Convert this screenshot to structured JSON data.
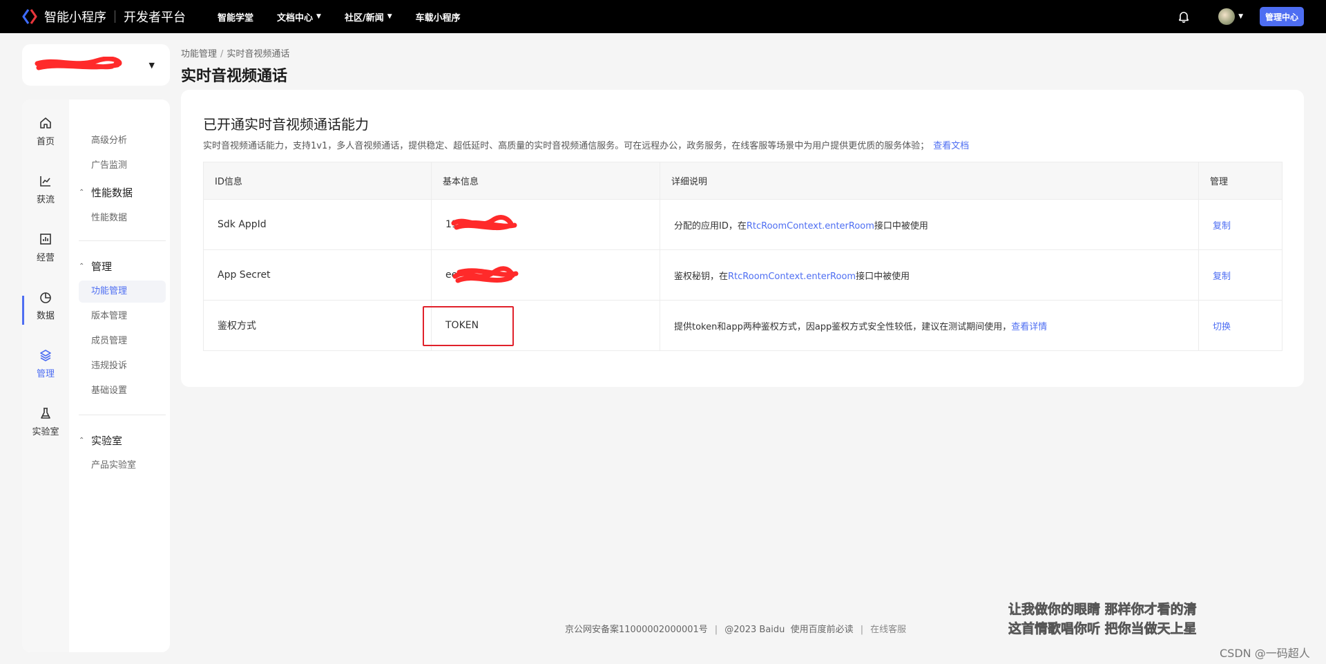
{
  "topbar": {
    "logo_name": "智能小程序",
    "logo_sub": "开发者平台",
    "nav": [
      {
        "label": "智能学堂",
        "caret": false
      },
      {
        "label": "文档中心",
        "caret": true
      },
      {
        "label": "社区/新闻",
        "caret": true
      },
      {
        "label": "车载小程序",
        "caret": false
      }
    ],
    "admin_label": "管理中心"
  },
  "sidebar": {
    "rail": [
      {
        "label": "首页",
        "icon": "home-icon"
      },
      {
        "label": "获流",
        "icon": "trend-icon"
      },
      {
        "label": "经营",
        "icon": "bar-chart-icon"
      },
      {
        "label": "数据",
        "icon": "pie-chart-icon"
      },
      {
        "label": "管理",
        "icon": "layers-icon",
        "active": true
      },
      {
        "label": "实验室",
        "icon": "flask-icon"
      }
    ],
    "sub": {
      "item_adv": "高级分析",
      "item_ad": "广告监测",
      "group_perf": "性能数据",
      "item_perf": "性能数据",
      "group_manage": "管理",
      "item_func": "功能管理",
      "item_version": "版本管理",
      "item_member": "成员管理",
      "item_violation": "违规投诉",
      "item_basic": "基础设置",
      "group_lab": "实验室",
      "item_lab": "产品实验室"
    }
  },
  "breadcrumb": {
    "parent": "功能管理",
    "sep": "/",
    "current": "实时音视频通话"
  },
  "page_title": "实时音视频通话",
  "card": {
    "title": "已开通实时音视频通话能力",
    "desc": "实时音视频通话能力，支持1v1，多人音视频通话，提供稳定、超低延时、高质量的实时音视频通信服务。可在远程办公，政务服务，在线客服等场景中为用户提供更优质的服务体验；",
    "doc_link": "查看文档"
  },
  "table": {
    "headers": [
      "ID信息",
      "基本信息",
      "详细说明",
      "管理"
    ],
    "rows": [
      {
        "name": "Sdk AppId",
        "value": "11",
        "desc_pre": "分配的应用ID，在",
        "desc_link": "RtcRoomContext.enterRoom",
        "desc_post": "接口中被使用",
        "action": "复制"
      },
      {
        "name": "App Secret",
        "value": "ee",
        "desc_pre": "鉴权秘钥，在",
        "desc_link": "RtcRoomContext.enterRoom",
        "desc_post": "接口中被使用",
        "action": "复制"
      },
      {
        "name": "鉴权方式",
        "value": "TOKEN",
        "desc_pre": "提供token和app两种鉴权方式，因app鉴权方式安全性较低，建议在测试期间使用，",
        "desc_link": "查看详情",
        "desc_post": "",
        "action": "切换"
      }
    ]
  },
  "footer": {
    "icp": "京公网安备案11000002000001号",
    "sep": "|",
    "copyright": "@2023 Baidu",
    "terms": "使用百度前必读",
    "service": "在线客服"
  },
  "overlay": {
    "line1": "让我做你的眼睛 那样你才看的清",
    "line2": "这首情歌唱你听 把你当做天上星",
    "watermark": "CSDN @一码超人"
  },
  "colors": {
    "accent": "#4e6ef2",
    "redact": "#ff2a2a",
    "highlight": "#e0202a"
  }
}
